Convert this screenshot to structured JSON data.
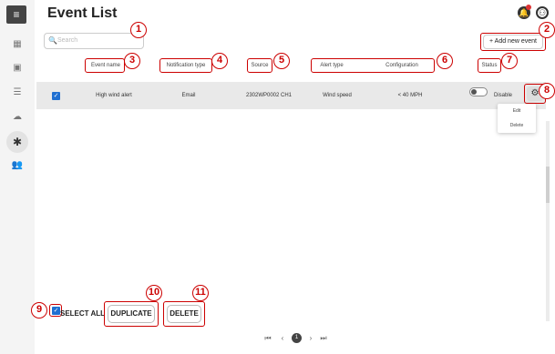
{
  "sidebar": {
    "menu_glyph": "≡",
    "items": [
      {
        "name": "dashboard-icon",
        "glyph": "▦"
      },
      {
        "name": "reports-icon",
        "glyph": "▣"
      },
      {
        "name": "list-icon",
        "glyph": "☰"
      },
      {
        "name": "weather-icon",
        "glyph": "☁"
      },
      {
        "name": "settings-icon",
        "glyph": "✱"
      },
      {
        "name": "users-icon",
        "glyph": "👥"
      }
    ]
  },
  "header": {
    "title": "Event List",
    "bell_glyph": "🔔",
    "user_glyph": "⚇"
  },
  "search": {
    "placeholder": "Search",
    "glyph": "🔍"
  },
  "add_button": {
    "label": "+ Add new event"
  },
  "columns": {
    "event_name": "Event name",
    "notification_type": "Notification type",
    "source": "Source",
    "alert_type": "Alert type",
    "configuration": "Configuration",
    "status": "Status"
  },
  "row": {
    "checked": true,
    "event_name": "High wind alert",
    "notification_type": "Email",
    "source": "2302WP0002 CH1",
    "alert_type": "Wind speed",
    "configuration": "< 40 MPH",
    "status_label": "Disable",
    "check_glyph": "✓",
    "gear_glyph": "⚙"
  },
  "row_menu": {
    "items": [
      "Edit",
      "Delete"
    ]
  },
  "footer": {
    "select_all_label": "SELECT ALL",
    "duplicate_label": "DUPLICATE",
    "delete_label": "DELETE"
  },
  "pagination": {
    "first": "⏮",
    "prev": "‹",
    "current": "1",
    "next": "›",
    "last": "⏭"
  },
  "callouts": [
    "1",
    "2",
    "3",
    "4",
    "5",
    "6",
    "7",
    "8",
    "9",
    "10",
    "11"
  ],
  "colors": {
    "accent": "#1f6fd1",
    "callout": "#cc0000",
    "row_bg": "#e9e9e9"
  }
}
